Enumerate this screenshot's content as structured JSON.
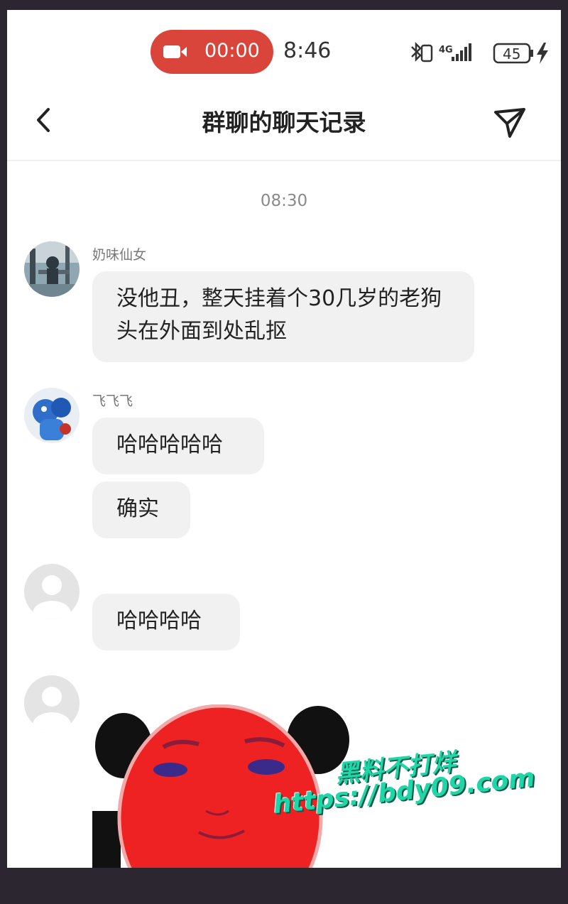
{
  "status_bar": {
    "recording_time": "00:00",
    "clock": "8:46",
    "network": "4G",
    "battery": "45"
  },
  "header": {
    "title": "群聊的聊天记录"
  },
  "chat": {
    "timestamp": "08:30",
    "messages": [
      {
        "sender": "奶味仙女",
        "text": "没他丑，整天挂着个30几岁的老狗头在外面到处乱抠"
      },
      {
        "sender": "飞飞飞",
        "text": "哈哈哈哈哈"
      },
      {
        "sender": "",
        "text": "确实"
      },
      {
        "sender": "",
        "text": "哈哈哈哈"
      },
      {
        "sender": "",
        "type": "sticker",
        "icon": "red-panda-face-sticker"
      }
    ]
  },
  "watermark": {
    "line1": "黑料不打烊",
    "line2": "https://bdy09.com"
  },
  "colors": {
    "record_pill": "#d9453b",
    "bubble": "#f1f1f1",
    "watermark": "#1fd6a8"
  }
}
